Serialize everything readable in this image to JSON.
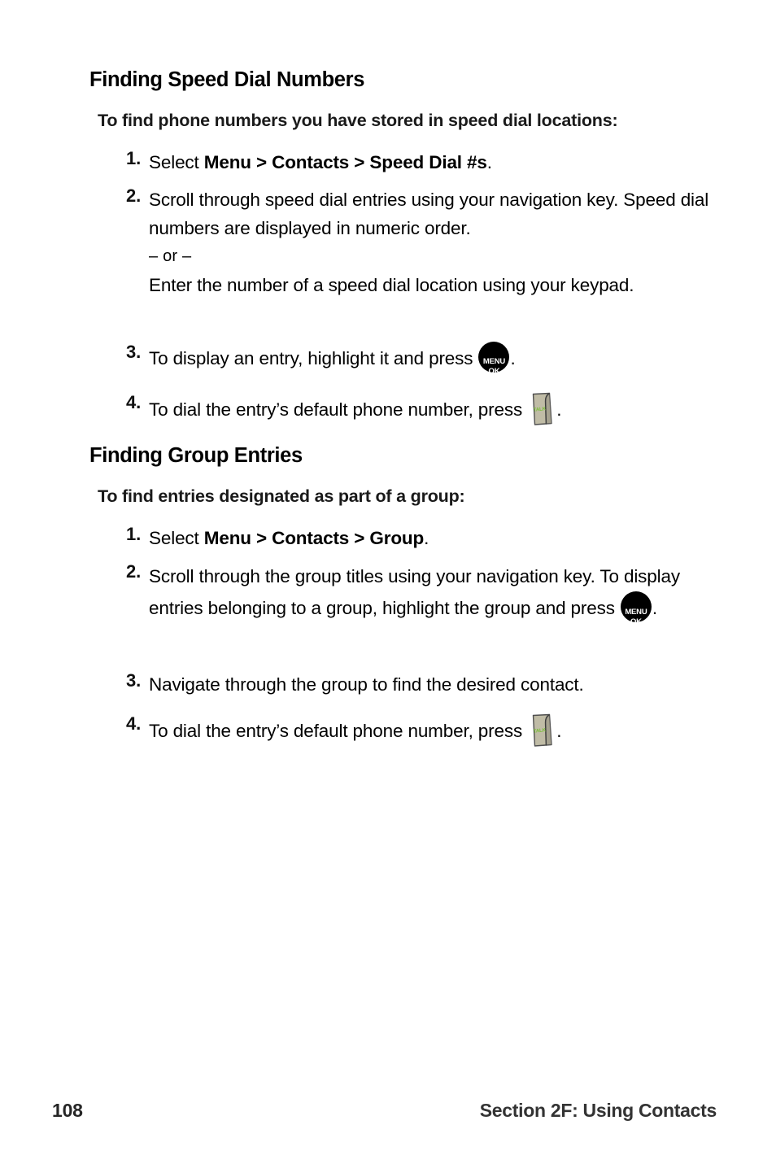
{
  "page": {
    "number": "108",
    "footer_section": "Section 2F: Using Contacts"
  },
  "sections": [
    {
      "heading": "Finding Speed Dial Numbers",
      "lead_in": "To find phone numbers you have stored in speed dial locations:",
      "steps": [
        {
          "number": "1.",
          "parts": {
            "p1": "Select ",
            "b1": "Menu",
            "c1": " > ",
            "b2": "Contacts",
            "c2": " > ",
            "b3": "Speed Dial #s",
            "p2": "."
          }
        },
        {
          "number": "2.",
          "parts": {
            "line1": "Scroll through speed dial entries using your navigation key. Speed dial numbers are displayed in numeric order.",
            "separator": "– or –",
            "line2": "Enter the number of a speed dial location using your keypad."
          }
        },
        {
          "number": "3.",
          "parts": {
            "p1": "To display an entry, highlight it and press ",
            "icon": "menu-ok-key",
            "p2": "."
          }
        },
        {
          "number": "4.",
          "parts": {
            "p1": "To dial the entry’s default phone number, press ",
            "icon": "talk-key",
            "p2": "."
          }
        }
      ]
    },
    {
      "heading": "Finding Group Entries",
      "lead_in": "To find entries designated as part of a group:",
      "steps": [
        {
          "number": "1.",
          "parts": {
            "p1": "Select ",
            "b1": "Menu",
            "c1": " > ",
            "b2": "Contacts",
            "c2": " > ",
            "b3": "Group",
            "p2": "."
          }
        },
        {
          "number": "2.",
          "parts": {
            "p1": "Scroll through the group titles using your navigation key. To display entries belonging to a group, highlight the group and press ",
            "icon": "menu-ok-key",
            "p2": "."
          }
        },
        {
          "number": "3.",
          "parts": {
            "p1": "Navigate through the group to find the desired contact."
          }
        },
        {
          "number": "4.",
          "parts": {
            "p1": "To dial the entry’s default phone number, press ",
            "icon": "talk-key",
            "p2": "."
          }
        }
      ]
    }
  ],
  "icons": {
    "menu_ok": {
      "line1": "MENU",
      "line2": "OK",
      "background": "#000000",
      "text_color": "#ffffff"
    },
    "talk": {
      "label": "TALK",
      "face_color": "#c0bca6",
      "edge_color": "#4b4b4b",
      "label_color": "#7bbf3a"
    }
  }
}
